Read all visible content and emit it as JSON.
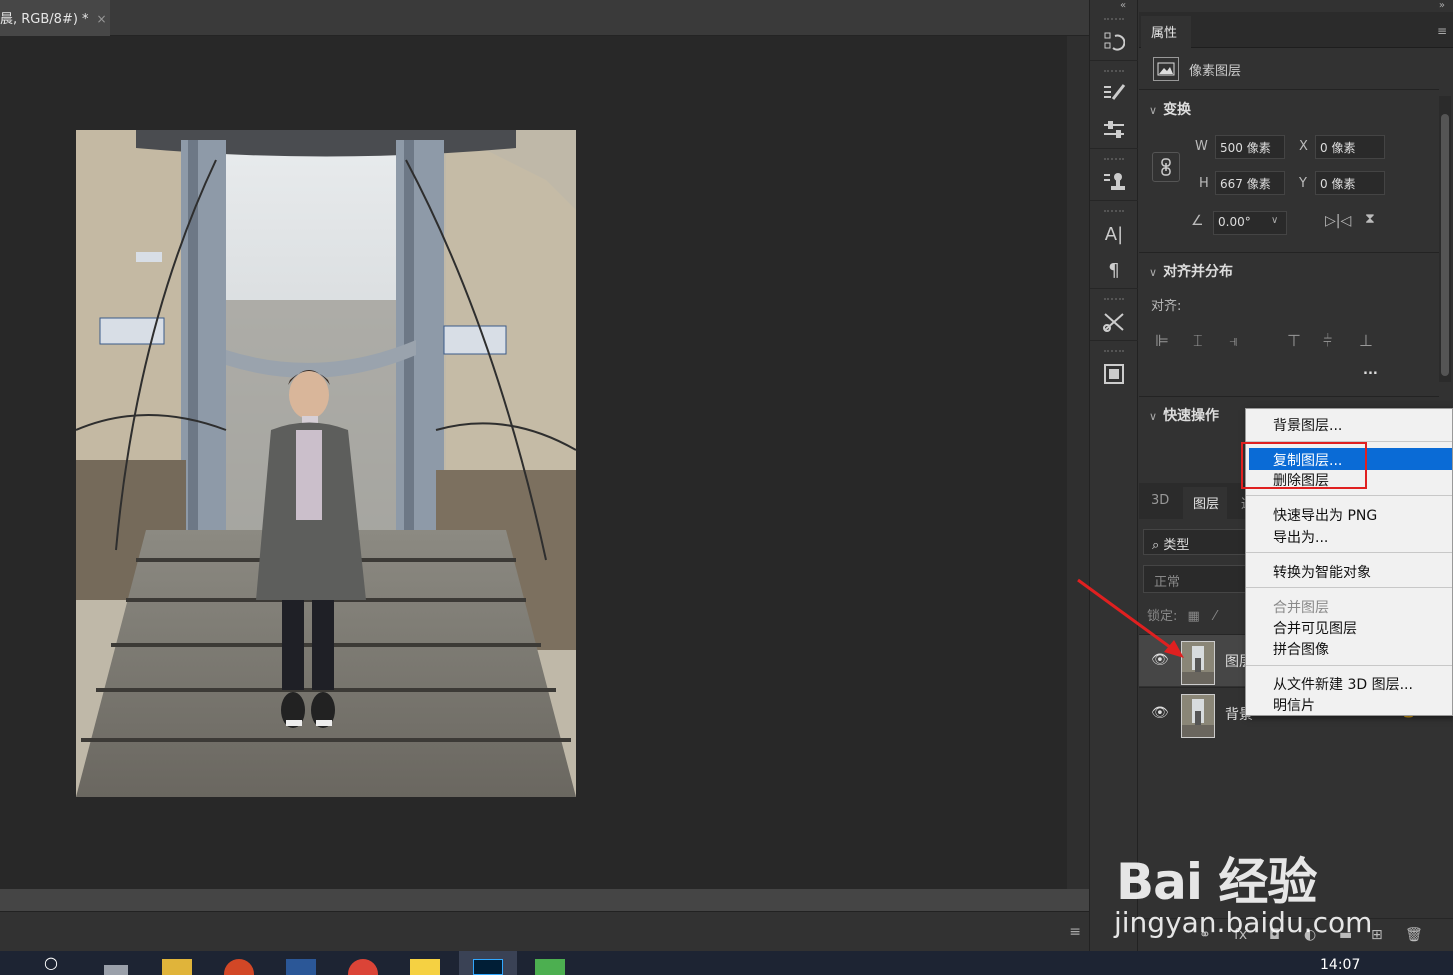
{
  "document": {
    "tab_title": "晨, RGB/8#) *",
    "close_glyph": "×"
  },
  "panel_collapse_glyphs": {
    "left": "«",
    "right": "»"
  },
  "toolstrip": {
    "icons": [
      "history-icon",
      "brush-presets-icon",
      "adjustments-icon",
      "clone-source-icon",
      "character-icon",
      "paragraph-icon",
      "tool-presets-icon",
      "libraries-icon"
    ]
  },
  "properties": {
    "tab_label": "属性",
    "layer_type": "像素图层",
    "transform": {
      "title": "变换",
      "w_label": "W",
      "w_value": "500 像素",
      "h_label": "H",
      "h_value": "667 像素",
      "x_label": "X",
      "x_value": "0 像素",
      "y_label": "Y",
      "y_value": "0 像素",
      "angle_value": "0.00°"
    },
    "align": {
      "title": "对齐并分布",
      "align_label": "对齐:",
      "more": "..."
    },
    "quick_actions": {
      "title": "快速操作"
    }
  },
  "layers_panel": {
    "tabs": [
      "3D",
      "图层",
      "通"
    ],
    "filter_label": "类型",
    "blend_mode": "正常",
    "lock_label": "锁定:",
    "layers": [
      {
        "name": "图层"
      },
      {
        "name": "背景"
      }
    ]
  },
  "context_menu": {
    "items": [
      {
        "label": "背景图层..."
      },
      {
        "label": "复制图层..."
      },
      {
        "label": "删除图层"
      },
      {
        "label": "快速导出为 PNG"
      },
      {
        "label": "导出为..."
      },
      {
        "label": "转换为智能对象"
      },
      {
        "label": "合并图层"
      },
      {
        "label": "合并可见图层"
      },
      {
        "label": "拼合图像"
      },
      {
        "label": "从文件新建 3D 图层..."
      },
      {
        "label": "明信片"
      }
    ],
    "highlight_index": 1,
    "highlight_color": "#0a6bd6",
    "annotation_color": "#e02020"
  },
  "watermark": {
    "logo": "Bai 经验",
    "url": "jingyan.baidu.com"
  },
  "taskbar": {
    "clock": "14:07"
  }
}
